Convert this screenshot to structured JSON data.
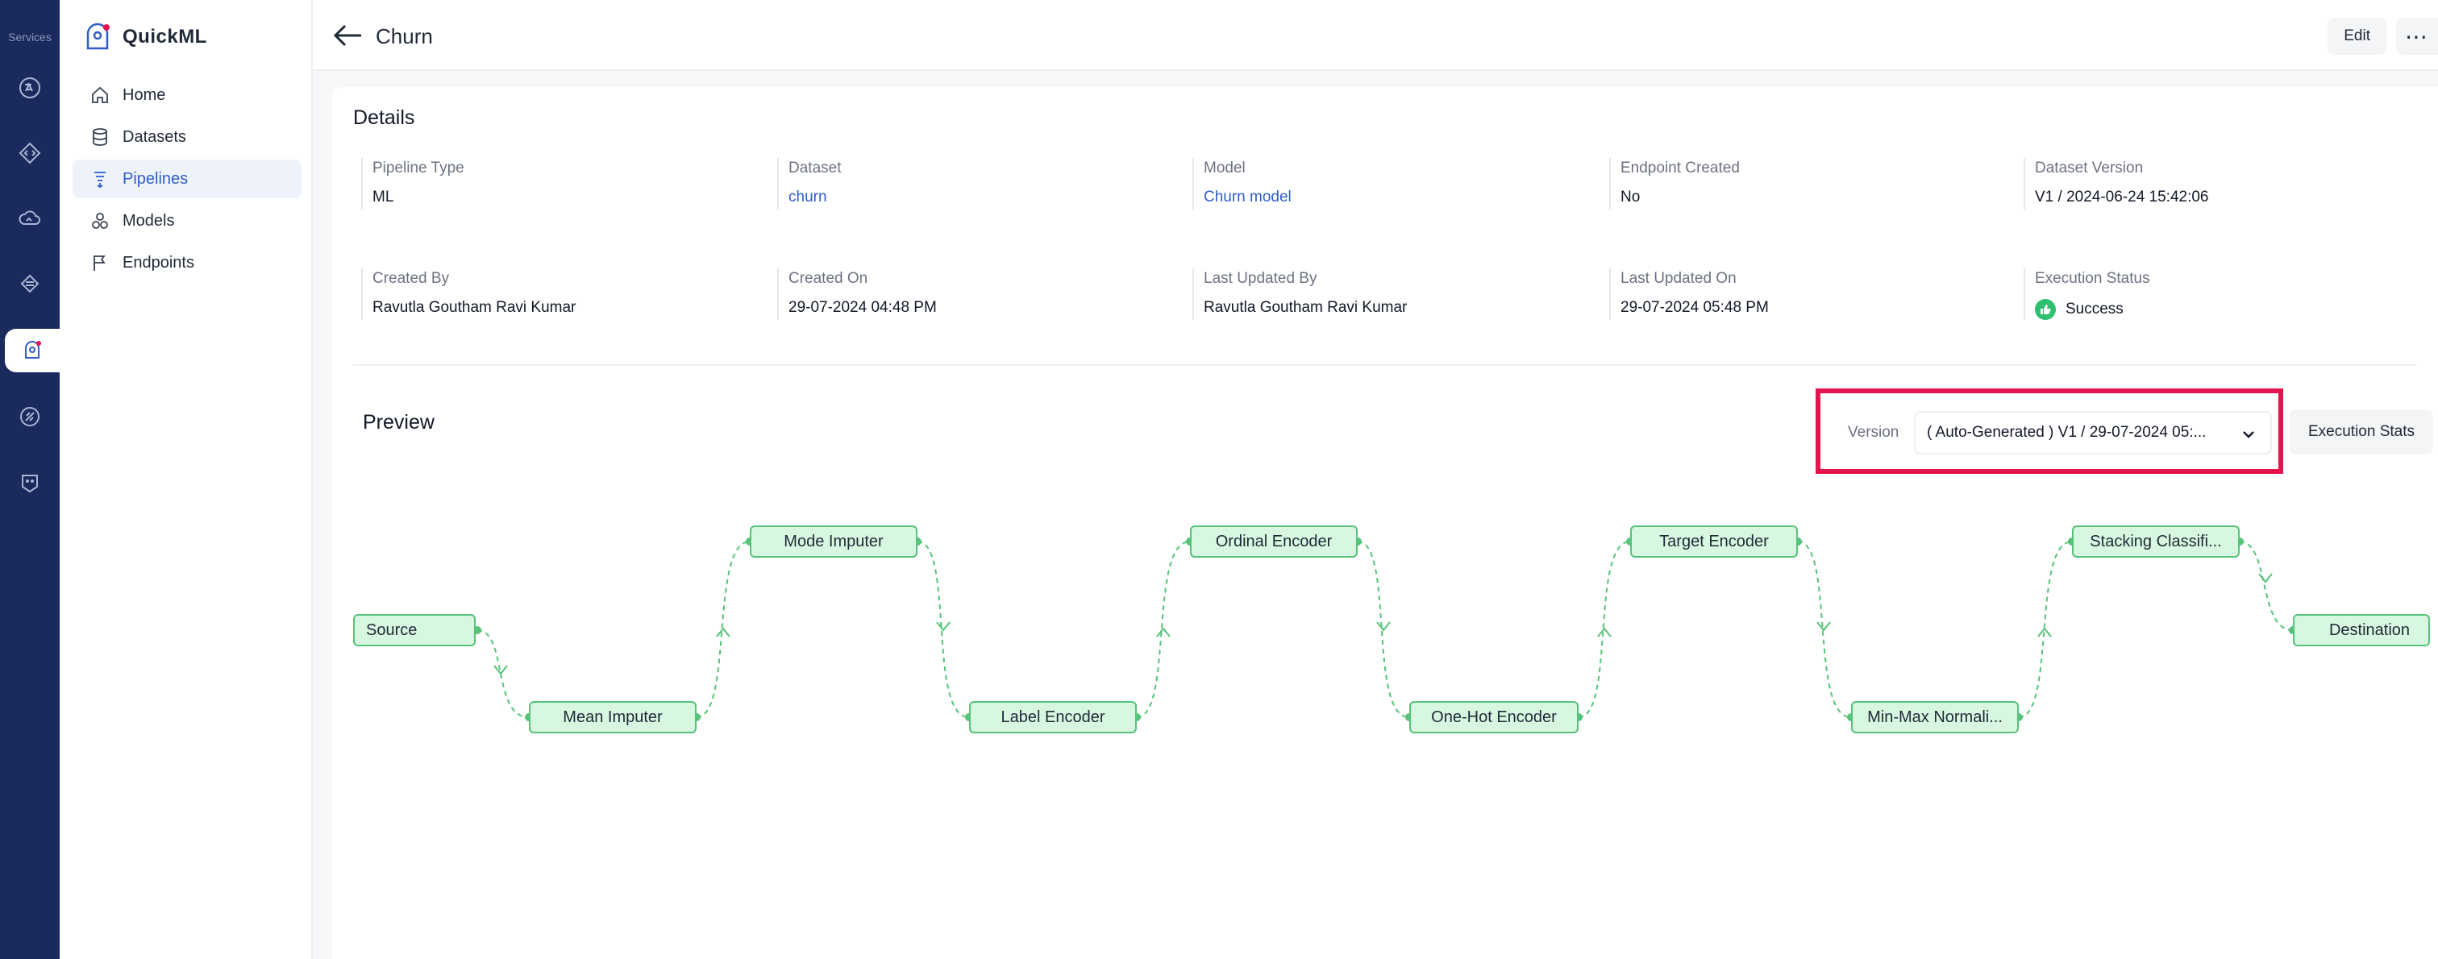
{
  "rail": {
    "label": "Services",
    "bg": "#1a2a5c"
  },
  "brand": {
    "name": "QuickML"
  },
  "nav": {
    "items": [
      {
        "label": "Home",
        "icon": "home-icon"
      },
      {
        "label": "Datasets",
        "icon": "database-icon"
      },
      {
        "label": "Pipelines",
        "icon": "pipeline-icon",
        "active": true
      },
      {
        "label": "Models",
        "icon": "models-icon"
      },
      {
        "label": "Endpoints",
        "icon": "flag-icon"
      }
    ]
  },
  "header": {
    "title": "Churn",
    "edit_label": "Edit",
    "more_label": "⋯"
  },
  "details": {
    "title": "Details",
    "fields": [
      {
        "label": "Pipeline Type",
        "value": "ML"
      },
      {
        "label": "Dataset",
        "value": "churn"
      },
      {
        "label": "Model",
        "value": "Churn model"
      },
      {
        "label": "Endpoint Created",
        "value": "No"
      },
      {
        "label": "Dataset Version",
        "value": "V1 / 2024-06-24 15:42:06"
      },
      {
        "label": "Created By",
        "value": "Ravutla Goutham Ravi Kumar"
      },
      {
        "label": "Created On",
        "value": "29-07-2024 04:48 PM"
      },
      {
        "label": "Last Updated By",
        "value": "Ravutla Goutham Ravi Kumar"
      },
      {
        "label": "Last Updated On",
        "value": "29-07-2024 05:48 PM"
      },
      {
        "label": "Execution Status",
        "value": "Success"
      }
    ]
  },
  "preview": {
    "title": "Preview",
    "version_label": "Version",
    "version_value": "( Auto-Generated ) V1 / 29-07-2024 05:...",
    "exec_stats_label": "Execution Stats",
    "highlight_color": "#e4144d"
  },
  "pipeline": {
    "nodes": [
      {
        "label": "Source"
      },
      {
        "label": "Mean Imputer"
      },
      {
        "label": "Mode Imputer"
      },
      {
        "label": "Label Encoder"
      },
      {
        "label": "Ordinal Encoder"
      },
      {
        "label": "One-Hot Encoder"
      },
      {
        "label": "Target Encoder"
      },
      {
        "label": "Min-Max Normali..."
      },
      {
        "label": "Stacking Classifi..."
      },
      {
        "label": "Destination"
      }
    ],
    "node_fill": "#d8f7e1",
    "node_border": "#56c27a",
    "accent": "#2f5dc8",
    "success": "#2fbf71"
  }
}
